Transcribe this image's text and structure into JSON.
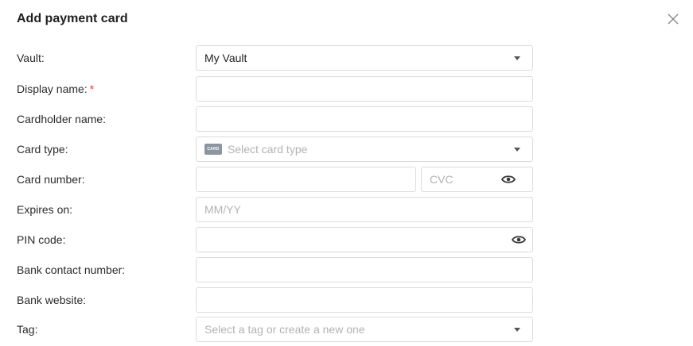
{
  "dialog": {
    "title": "Add payment card",
    "close_icon": "close-icon"
  },
  "form": {
    "vault": {
      "label": "Vault:",
      "value": "My Vault"
    },
    "display_name": {
      "label": "Display name:",
      "required_mark": "*",
      "value": ""
    },
    "cardholder_name": {
      "label": "Cardholder name:",
      "value": ""
    },
    "card_type": {
      "label": "Card type:",
      "chip_text": "CARD",
      "placeholder": "Select card type"
    },
    "card_number": {
      "label": "Card number:",
      "value": "",
      "cvc_placeholder": "CVC"
    },
    "expires_on": {
      "label": "Expires on:",
      "placeholder": "MM/YY"
    },
    "pin_code": {
      "label": "PIN code:",
      "value": ""
    },
    "bank_contact_number": {
      "label": "Bank contact number:",
      "value": ""
    },
    "bank_website": {
      "label": "Bank website:",
      "value": ""
    },
    "tag": {
      "label": "Tag:",
      "placeholder": "Select a tag or create a new one"
    }
  },
  "colors": {
    "required": "#e23b3b",
    "border": "#dcdcdc",
    "placeholder": "#b3b3b3"
  }
}
